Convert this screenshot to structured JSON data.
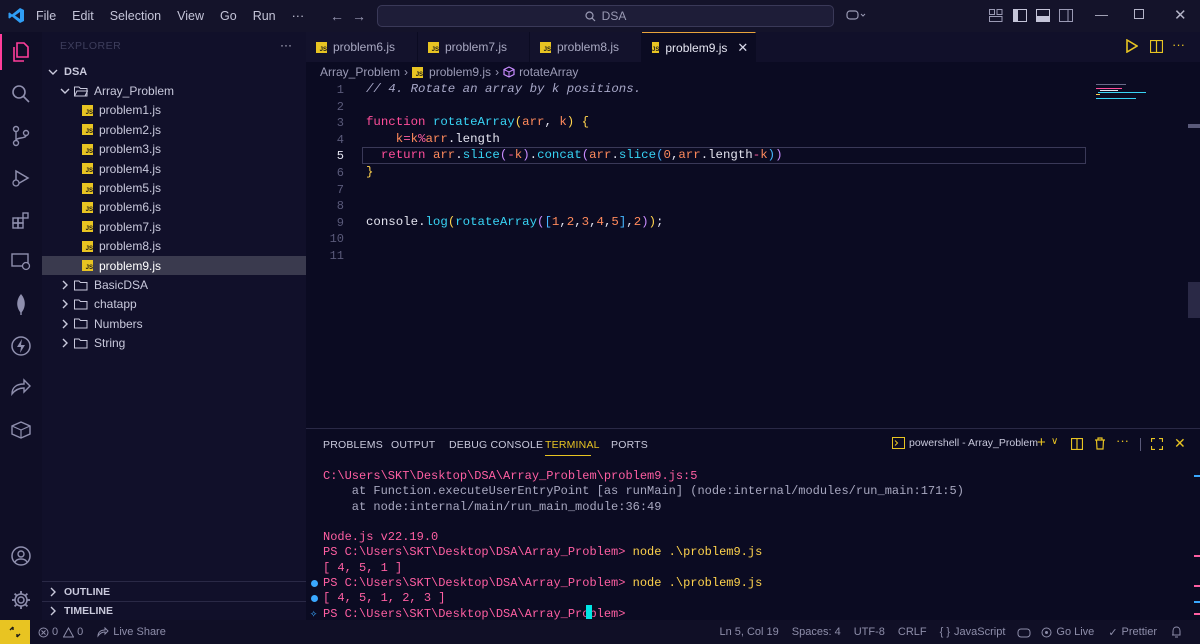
{
  "menu": [
    "File",
    "Edit",
    "Selection",
    "View",
    "Go",
    "Run",
    "···"
  ],
  "search": {
    "label": "DSA"
  },
  "explorer": {
    "title": "EXPLORER",
    "root": "DSA",
    "folder": "Array_Problem",
    "files": [
      "problem1.js",
      "problem2.js",
      "problem3.js",
      "problem4.js",
      "problem5.js",
      "problem6.js",
      "problem7.js",
      "problem8.js",
      "problem9.js"
    ],
    "selected_file": "problem9.js",
    "other_folders": [
      "BasicDSA",
      "chatapp",
      "Numbers",
      "String"
    ],
    "outline": "OUTLINE",
    "timeline": "TIMELINE"
  },
  "tabs": [
    {
      "label": "problem6.js"
    },
    {
      "label": "problem7.js"
    },
    {
      "label": "problem8.js"
    },
    {
      "label": "problem9.js",
      "active": true
    }
  ],
  "breadcrumb": {
    "folder": "Array_Problem",
    "file": "problem9.js",
    "symbol": "rotateArray"
  },
  "editor": {
    "line_numbers": [
      "1",
      "2",
      "3",
      "4",
      "5",
      "6",
      "7",
      "8",
      "9",
      "10",
      "11"
    ],
    "current_line": "5"
  },
  "panel": {
    "tabs": [
      "PROBLEMS",
      "OUTPUT",
      "DEBUG CONSOLE",
      "TERMINAL",
      "PORTS"
    ],
    "active_tab": "TERMINAL",
    "terminal_name": "powershell - Array_Problem",
    "lines": [
      {
        "text": "C:\\Users\\SKT\\Desktop\\DSA\\Array_Problem\\problem9.js:5",
        "color": "#ff5fa2"
      },
      {
        "text": "    at Function.executeUserEntryPoint [as runMain] (node:internal/modules/run_main:171:5)",
        "color": "#a8a8c0"
      },
      {
        "text": "    at node:internal/main/run_main_module:36:49",
        "color": "#a8a8c0"
      },
      {
        "text": "",
        "color": "#a8a8c0"
      },
      {
        "text": "Node.js v22.19.0",
        "color": "#ff5fa2"
      },
      {
        "prompt": "PS C:\\Users\\SKT\\Desktop\\DSA\\Array_Problem> ",
        "cmd": "node .\\problem9.js",
        "color": "#ff5fa2"
      },
      {
        "text": "[ 4, 5, 1 ]",
        "color": "#ff5fa2"
      },
      {
        "prompt": "PS C:\\Users\\SKT\\Desktop\\DSA\\Array_Problem> ",
        "cmd": "node .\\problem9.js",
        "color": "#ff5fa2",
        "dot": "#3aa8ff"
      },
      {
        "text": "[ 4, 5, 1, 2, 3 ]",
        "color": "#ff5fa2",
        "dot": "#3aa8ff"
      },
      {
        "prompt": "PS C:\\Users\\SKT\\Desktop\\DSA\\Array_Problem> ",
        "cmd": "",
        "color": "#ff5fa2",
        "sparkle": true
      }
    ]
  },
  "status": {
    "errors": "0",
    "warnings": "0",
    "live_share": "Live Share",
    "position": "Ln 5, Col 19",
    "spaces": "Spaces: 4",
    "encoding": "UTF-8",
    "eol": "CRLF",
    "language": "JavaScript",
    "go_live": "Go Live",
    "prettier": "Prettier"
  },
  "colors": {
    "accent": "#e8c422",
    "background": "#0b0b22",
    "sidebar": "#11102a",
    "keyword": "#ff4e9a",
    "function": "#38d4f5",
    "terminal_text": "#ff5fa2"
  }
}
